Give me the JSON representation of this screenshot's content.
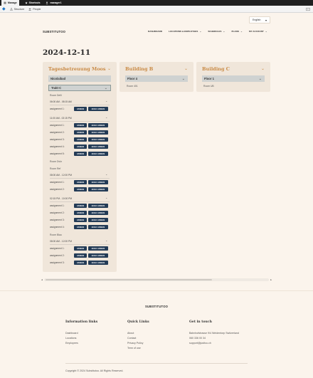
{
  "os_bar": {
    "items": [
      {
        "label": "Manage",
        "icon": "menu-icon"
      },
      {
        "label": "Shortcuts",
        "icon": "star-icon"
      },
      {
        "label": "manager1",
        "icon": "user-icon"
      }
    ]
  },
  "toolbar": {
    "items": [
      {
        "label": "Structure",
        "icon": "sitemap-icon"
      },
      {
        "label": "People",
        "icon": "people-icon"
      }
    ]
  },
  "language": {
    "selected": "English"
  },
  "header": {
    "brand": "SUBSTITUTOO",
    "nav": [
      {
        "label": "DASHBOARD",
        "has_caret": false
      },
      {
        "label": "LOCATIONS & EMPLOYEES",
        "has_caret": true
      },
      {
        "label": "SCHEDULES",
        "has_caret": true
      },
      {
        "label": "PLANS",
        "has_caret": true
      },
      {
        "label": "MY ACCOUNT",
        "has_caret": true
      }
    ]
  },
  "page": {
    "date": "2024-12-11"
  },
  "buttons": {
    "assign": "ASSIGN",
    "bulk": "BULK ASSIGN"
  },
  "buildings": [
    {
      "name": "Tagesbetreuung Moos",
      "floors": [
        {
          "name": "Nicolaibad",
          "state": "collapsed"
        },
        {
          "name": "Trakt C",
          "state": "expanded"
        }
      ],
      "rooms": [
        {
          "name": "Room Delli",
          "slots": [
            {
              "time": "06:00 AM - 08:15 AM",
              "assignments": [
                "assignment 1:"
              ]
            },
            {
              "time": "11:00 AM - 02:15 PM",
              "assignments": [
                "assignment 1:",
                "assignment 2:",
                "assignment 3:",
                "assignment 4:",
                "assignment 5:"
              ]
            }
          ]
        },
        {
          "name": "Room Dvkr",
          "slots": []
        },
        {
          "name": "Room Ref",
          "slots": [
            {
              "time": "08:00 AM - 12:00 PM",
              "assignments": [
                "assignment 1:",
                "assignment 2:"
              ]
            },
            {
              "time": "02:15 PM - 10:00 PM",
              "assignments": [
                "assignment 1:",
                "assignment 2:",
                "assignment 3:",
                "assignment 4:"
              ]
            }
          ]
        },
        {
          "name": "Room Blau",
          "slots": [
            {
              "time": "08:00 AM - 12:00 PM",
              "assignments": [
                "assignment 1:",
                "assignment 2:",
                "assignment 3:"
              ]
            }
          ]
        }
      ]
    },
    {
      "name": "Building B",
      "floors": [
        {
          "name": "Floor 4",
          "state": "expanded"
        }
      ],
      "rooms": [
        {
          "name": "Room 401",
          "slots": []
        }
      ]
    },
    {
      "name": "Building C",
      "floors": [
        {
          "name": "Floor 1",
          "state": "expanded"
        }
      ],
      "rooms": [
        {
          "name": "Room UB",
          "slots": []
        }
      ]
    }
  ],
  "footer": {
    "brand": "SUBSTITUTOO",
    "columns": [
      {
        "heading": "Information links",
        "links": [
          "Dashboard",
          "Locations",
          "Employees"
        ]
      },
      {
        "heading": "Quick Links",
        "links": [
          "About",
          "Contact",
          "Privacy Policy",
          "Term of use"
        ]
      },
      {
        "heading": "Get in touch",
        "links": [
          "Bahnhofstrasse 9/4 Weidentorp Switzerland",
          "060 336 00 34",
          "support@justtcu.ch"
        ]
      }
    ],
    "copyright": "Copyright © 2024 Substitutoo. All Rights Reserved."
  },
  "colors": {
    "accent": "#c98a45",
    "button": "#233b56",
    "page_bg": "#fbf4ec",
    "panel_bg": "#f0e6da"
  }
}
